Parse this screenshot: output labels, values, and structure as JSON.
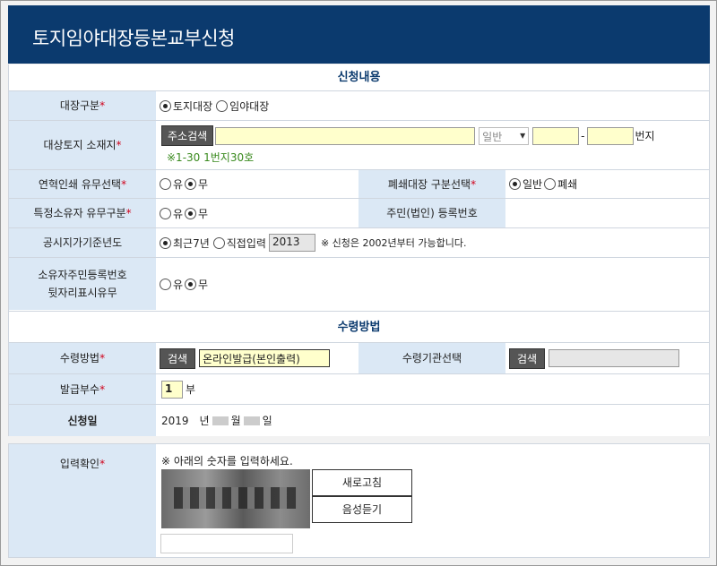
{
  "page": {
    "title": "토지임야대장등본교부신청"
  },
  "sections": {
    "apply": "신청내용",
    "receive": "수령방법"
  },
  "fields": {
    "ledger_type": {
      "label": "대장구분",
      "options": [
        "토지대장",
        "임야대장"
      ],
      "selected": "토지대장"
    },
    "location": {
      "label": "대상토지 소재지",
      "search_button": "주소검색",
      "address_value": "",
      "select_value": "일반",
      "number1": "",
      "separator": "-",
      "number2": "",
      "suffix": "번지",
      "note": "※1-30 1번지30호"
    },
    "history_print": {
      "label": "연혁인쇄 유무선택",
      "options": [
        "유",
        "무"
      ],
      "selected": "무"
    },
    "closed_ledger": {
      "label": "폐쇄대장 구분선택",
      "options": [
        "일반",
        "폐쇄"
      ],
      "selected": "일반"
    },
    "specific_owner": {
      "label": "특정소유자 유무구분",
      "options": [
        "유",
        "무"
      ],
      "selected": "무"
    },
    "resident_no": {
      "label": "주민(법인) 등록번호",
      "value": ""
    },
    "land_price_year": {
      "label": "공시지가기준년도",
      "options": [
        "최근7년",
        "직접입력"
      ],
      "selected": "최근7년",
      "year_value": "2013",
      "note": "※ 신청은 2002년부터 가능합니다."
    },
    "owner_id_display": {
      "label_line1": "소유자주민등록번호",
      "label_line2": "뒷자리표시유무",
      "options": [
        "유",
        "무"
      ],
      "selected": "무"
    },
    "receive_method": {
      "label": "수령방법",
      "search_button": "검색",
      "value": "온라인발급(본인출력)"
    },
    "receive_agency": {
      "label": "수령기관선택",
      "search_button": "검색",
      "value": ""
    },
    "copies": {
      "label": "발급부수",
      "value": "1",
      "suffix": "부"
    },
    "apply_date": {
      "label": "신청일",
      "year": "2019",
      "year_suffix": "년",
      "month_suffix": "월",
      "day_suffix": "일"
    },
    "captcha": {
      "label": "입력확인",
      "instruction": "※ 아래의 숫자를 입력하세요.",
      "refresh_button": "새로고침",
      "audio_button": "음성듣기",
      "input_value": ""
    }
  },
  "required_mark": "*"
}
